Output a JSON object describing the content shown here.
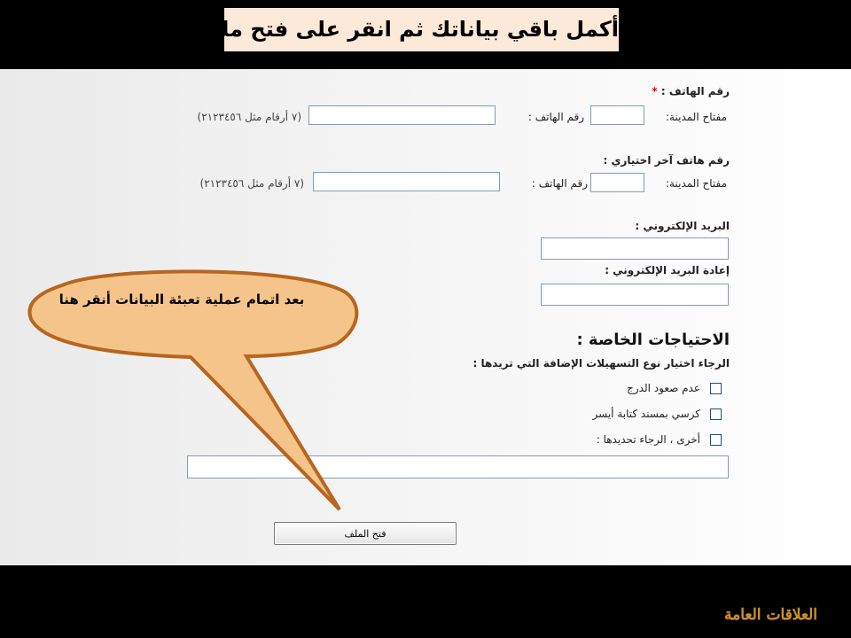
{
  "banner": {
    "title": "أكمل باقي بياناتك ثم انقر على فتح ملف"
  },
  "phone": {
    "label": "رقم الهاتف :",
    "required_mark": "*",
    "area_code_label": "مفتاح المدينة:",
    "number_label": "رقم الهاتف :",
    "hint": "(٧ أرقام مثل ٢١٢٣٤٥٦)",
    "area_code_value": "",
    "number_value": ""
  },
  "alt_phone": {
    "label": "رقم هاتف آخر اختياري :",
    "area_code_label": "مفتاح المدينة:",
    "number_label": "رقم الهاتف :",
    "hint": "(٧ أرقام مثل ٢١٢٣٤٥٦)",
    "area_code_value": "",
    "number_value": ""
  },
  "email": {
    "label": "البريد الإلكتروني :",
    "value": ""
  },
  "email_confirm": {
    "label": "إعادة البريد الإلكتروني :",
    "value": ""
  },
  "special_needs": {
    "title": "الاحتياجات الخاصة :",
    "prompt": "الرجاء اختيار نوع التسهيلات الإضافة التي تريدها :",
    "options": [
      {
        "label": "عدم صعود الدرج",
        "checked": false
      },
      {
        "label": "كرسي بمسند كتابة أيسر",
        "checked": false
      },
      {
        "label": "أخرى ، الرجاء تحديدها :",
        "checked": false
      }
    ],
    "other_value": ""
  },
  "callout": {
    "text": "بعد اتمام عملية تعبئة البيانات أنقر هنا"
  },
  "submit": {
    "label": "فتح الملف"
  },
  "footer": {
    "logo_text": "العلاقات العامة"
  },
  "colors": {
    "banner_bg": "#fde9d9",
    "callout_fill": "#f5c48a",
    "callout_stroke": "#b8651f",
    "logo": "#c8902c"
  }
}
